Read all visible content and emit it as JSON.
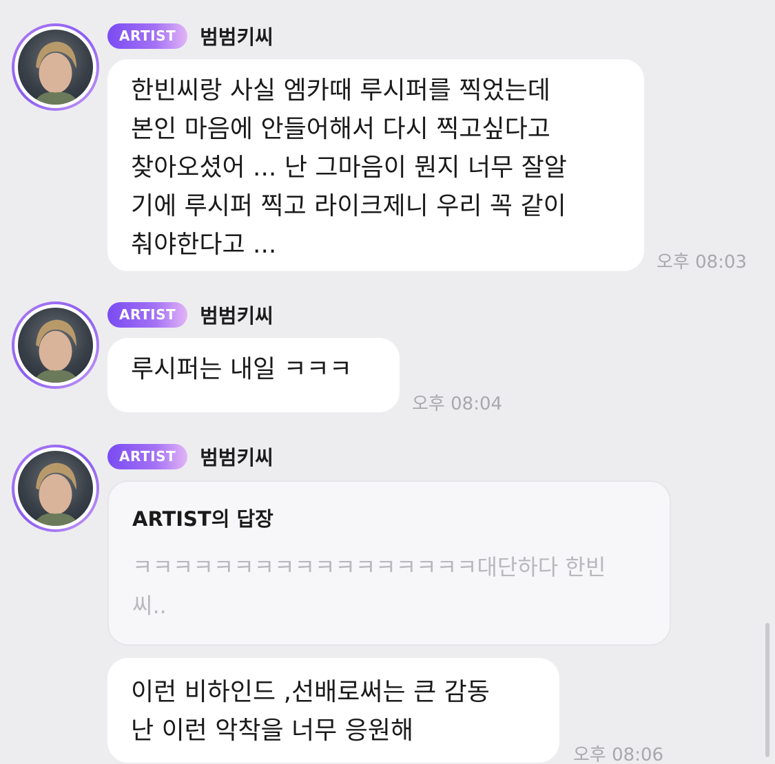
{
  "messages": [
    {
      "badge": "ARTIST",
      "sender": "범범키씨",
      "lines": [
        "한빈씨랑 사실 엠카때 루시퍼를 찍었는데",
        "본인 마음에 안들어해서 다시 찍고싶다고",
        "찾아오셨어 ... 난 그마음이 뭔지 너무 잘알",
        "기에 루시퍼 찍고 라이크제니 우리 꼭 같이",
        "춰야한다고 ..."
      ],
      "time": "오후 08:03"
    },
    {
      "badge": "ARTIST",
      "sender": "범범키씨",
      "lines": [
        "루시퍼는 내일 ㅋㅋㅋ"
      ],
      "time": "오후 08:04"
    },
    {
      "badge": "ARTIST",
      "sender": "범범키씨",
      "reply": {
        "title": "ARTIST의 답장",
        "lines": [
          "ㅋㅋㅋㅋㅋㅋㅋㅋㅋㅋㅋㅋㅋㅋㅋㅋㅋ대단하다 한빈",
          "씨.."
        ]
      },
      "lines": [
        "이런 비하인드 ,선배로써는 큰 감동",
        "난 이런 악착을 너무 응원해"
      ],
      "time": "오후 08:06"
    }
  ],
  "colors": {
    "background": "#ededf0",
    "bubble": "#ffffff",
    "badge_start": "#7a4bf2",
    "badge_end": "#e2b4f6",
    "timestamp": "#a8a8ad",
    "reply_text": "#b8b8bd"
  }
}
